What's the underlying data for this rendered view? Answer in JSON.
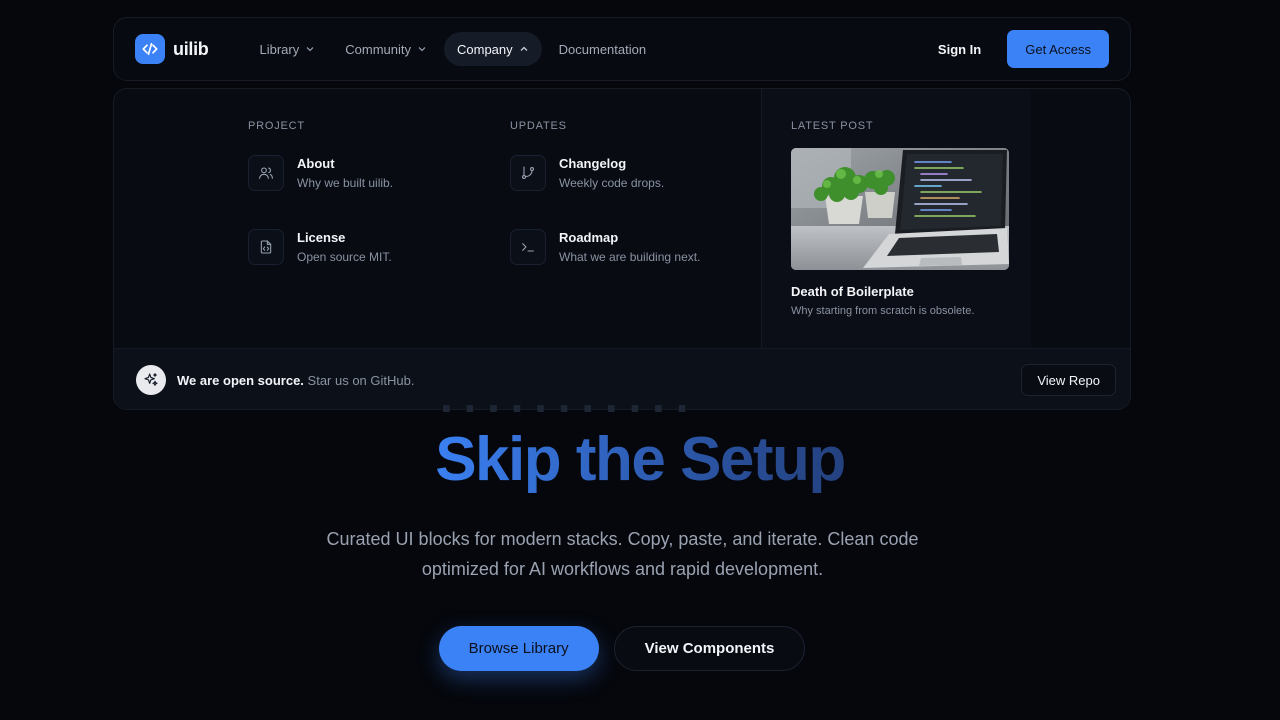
{
  "brand": {
    "name": "uilib",
    "accent": "#3b82f6"
  },
  "nav": {
    "items": [
      {
        "label": "Library",
        "has_dropdown": true,
        "active": false
      },
      {
        "label": "Community",
        "has_dropdown": true,
        "active": false
      },
      {
        "label": "Company",
        "has_dropdown": true,
        "active": true
      },
      {
        "label": "Documentation",
        "has_dropdown": false,
        "active": false
      }
    ],
    "sign_in": "Sign In",
    "get_access": "Get Access"
  },
  "dropdown": {
    "project": {
      "heading": "PROJECT",
      "items": [
        {
          "title": "About",
          "desc": "Why we built uilib.",
          "icon": "users-icon"
        },
        {
          "title": "License",
          "desc": "Open source MIT.",
          "icon": "file-code-icon"
        }
      ]
    },
    "updates": {
      "heading": "UPDATES",
      "items": [
        {
          "title": "Changelog",
          "desc": "Weekly code drops.",
          "icon": "git-branch-icon"
        },
        {
          "title": "Roadmap",
          "desc": "What we are building next.",
          "icon": "terminal-icon"
        }
      ]
    },
    "latest": {
      "heading": "LATEST POST",
      "title": "Death of Boilerplate",
      "desc": "Why starting from scratch is obsolete."
    },
    "footer": {
      "bold": "We are open source.",
      "text": " Star us on GitHub.",
      "button": "View Repo"
    }
  },
  "hero": {
    "title": "Skip the Setup",
    "subtitle_line1": "Curated UI blocks for modern stacks. Copy, paste, and iterate. Clean code",
    "subtitle_line2": "optimized for AI workflows and rapid development.",
    "primary_button": "Browse Library",
    "secondary_button": "View Components"
  }
}
